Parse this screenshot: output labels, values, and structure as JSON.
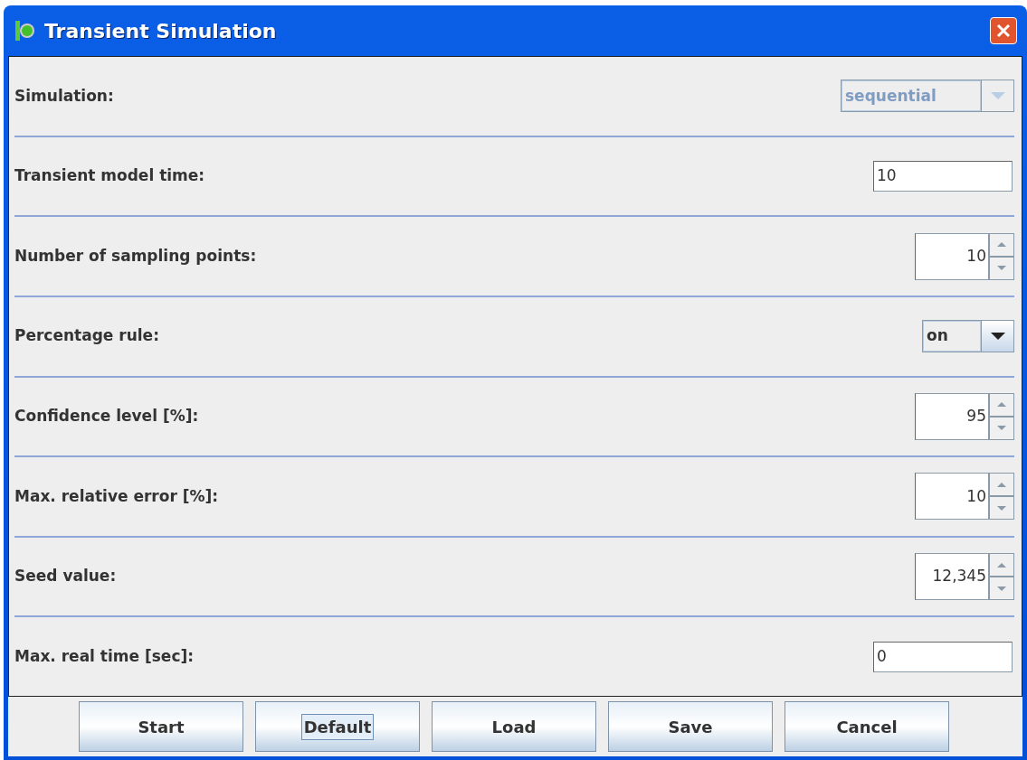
{
  "window": {
    "title": "Transient Simulation"
  },
  "rows": [
    {
      "kind": "combo",
      "label": "Simulation:",
      "value": "sequential",
      "disabled": true
    },
    {
      "kind": "text",
      "label": "Transient model time:",
      "value": "10"
    },
    {
      "kind": "spinner",
      "label": "Number of sampling points:",
      "value": "10"
    },
    {
      "kind": "combo",
      "label": "Percentage rule:",
      "value": "on",
      "disabled": false
    },
    {
      "kind": "spinner",
      "label": "Confidence level [%]:",
      "value": "95"
    },
    {
      "kind": "spinner",
      "label": "Max. relative error [%]:",
      "value": "10"
    },
    {
      "kind": "spinner",
      "label": "Seed value:",
      "value": "12,345"
    },
    {
      "kind": "text",
      "label": "Max. real time [sec]:",
      "value": "0"
    }
  ],
  "buttons": [
    {
      "label": "Start",
      "focused": false
    },
    {
      "label": "Default",
      "focused": true
    },
    {
      "label": "Load",
      "focused": false
    },
    {
      "label": "Save",
      "focused": false
    },
    {
      "label": "Cancel",
      "focused": false
    }
  ]
}
